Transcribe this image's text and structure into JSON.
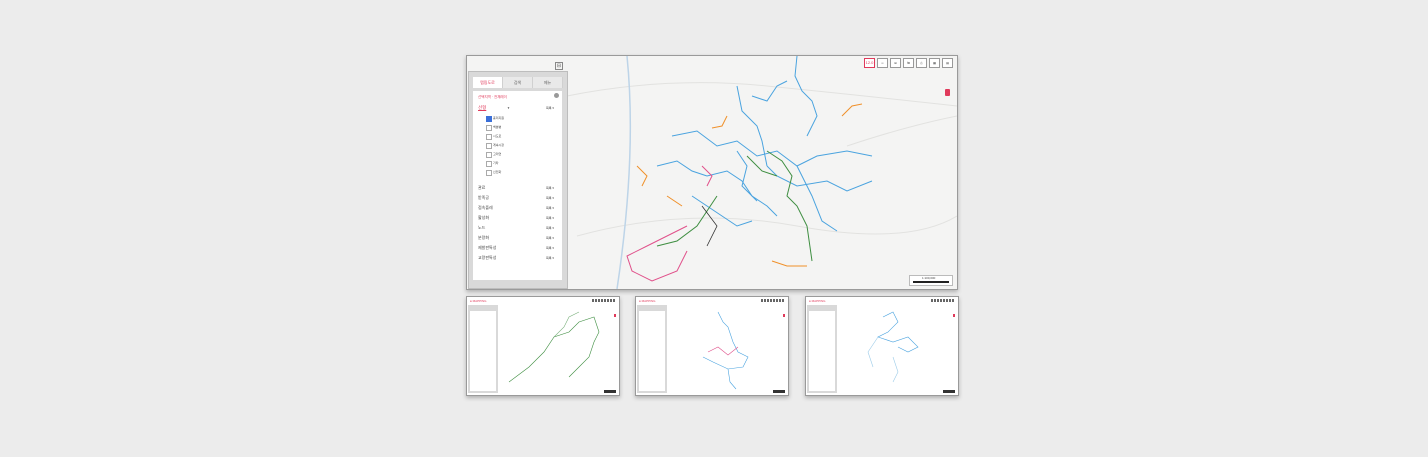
{
  "main_window": {
    "tabs": [
      {
        "label": "맵핑도로",
        "active": true
      },
      {
        "label": "검색",
        "active": false
      },
      {
        "label": "메뉴",
        "active": false
      }
    ],
    "collapse_label": "⊟",
    "breadcrumb": "선택지역 · 전체레이",
    "layers": [
      {
        "label": "선형",
        "more": "목록 ▾"
      },
      {
        "label": "관료",
        "more": "목록 ▾"
      },
      {
        "label": "받족공",
        "more": "목록 ▾"
      },
      {
        "label": "접속플레",
        "more": "목록 ▾"
      },
      {
        "label": "활성화",
        "more": "목록 ▾"
      },
      {
        "label": "노드",
        "more": "목록 ▾"
      },
      {
        "label": "분량화",
        "more": "목록 ▾"
      },
      {
        "label": "제발판특성",
        "more": "목록 ▾"
      },
      {
        "label": "교량판특성",
        "more": "목록 ▾"
      }
    ],
    "sublayers": [
      {
        "label": "총리지원",
        "checked": true
      },
      {
        "label": "백분병",
        "checked": false
      },
      {
        "label": "시도로",
        "checked": false
      },
      {
        "label": "게속시장",
        "checked": false
      },
      {
        "label": "고리연",
        "checked": false
      },
      {
        "label": "기타",
        "checked": false
      },
      {
        "label": "신전화",
        "checked": false
      }
    ],
    "toolbar": [
      {
        "label": "12.0",
        "icon": "zoom-level"
      },
      {
        "label": "═",
        "icon": "layers-icon"
      },
      {
        "label": "⊞",
        "icon": "grid-icon"
      },
      {
        "label": "⇆",
        "icon": "swap-icon"
      },
      {
        "label": "⎙",
        "icon": "print-icon"
      },
      {
        "label": "▦",
        "icon": "map-icon"
      },
      {
        "label": "▤",
        "icon": "list-icon"
      }
    ],
    "scale_label": "1:100,000",
    "scale_sub": "0   2km   5km"
  },
  "thumbnails": [
    {
      "logo": "● MAPPING",
      "network": "green"
    },
    {
      "logo": "● MAPPING",
      "network": "mixed"
    },
    {
      "logo": "● MAPPING",
      "network": "blue"
    }
  ],
  "colors": {
    "accent": "#e03a5b",
    "road_blue": "#4aa3df",
    "road_green": "#3e8e41",
    "road_orange": "#f0902a",
    "road_pink": "#e0508a",
    "checkbox": "#3a6fd8"
  }
}
